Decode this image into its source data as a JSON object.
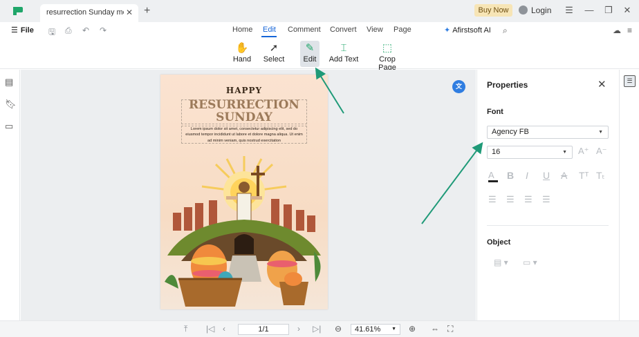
{
  "titlebar": {
    "tab_title": "resurrection Sunday mes...",
    "buy_now": "Buy Now",
    "login": "Login"
  },
  "toolbar": {
    "file": "File",
    "nav_tabs": [
      "Home",
      "Edit",
      "Comment",
      "Convert",
      "View",
      "Page"
    ],
    "active_tab": "Edit",
    "ai_label": "Afirstsoft AI",
    "tools": [
      "Hand",
      "Select",
      "Edit",
      "Add Text",
      "Crop Page"
    ],
    "active_tool": "Edit"
  },
  "document": {
    "heading_small": "HAPPY",
    "heading_line1": "RESURRECTION",
    "heading_line2": "SUNDAY",
    "body_text": "Lorem ipsum dolor sit amet, consectetur adipiscing elit, sed do eiusmod tempor incididunt ut labore et dolore magna aliqua. Ut enim ad minim veniam, quis nostrud exercitation"
  },
  "properties": {
    "title": "Properties",
    "font_section": "Font",
    "font_family": "Agency FB",
    "font_size": "16",
    "object_section": "Object"
  },
  "bottombar": {
    "page": "1/1",
    "zoom": "41.61%"
  },
  "colors": {
    "accent": "#1565d8",
    "annotation_arrow": "#1f9a78",
    "buy_now_bg": "#f7e5b6"
  }
}
